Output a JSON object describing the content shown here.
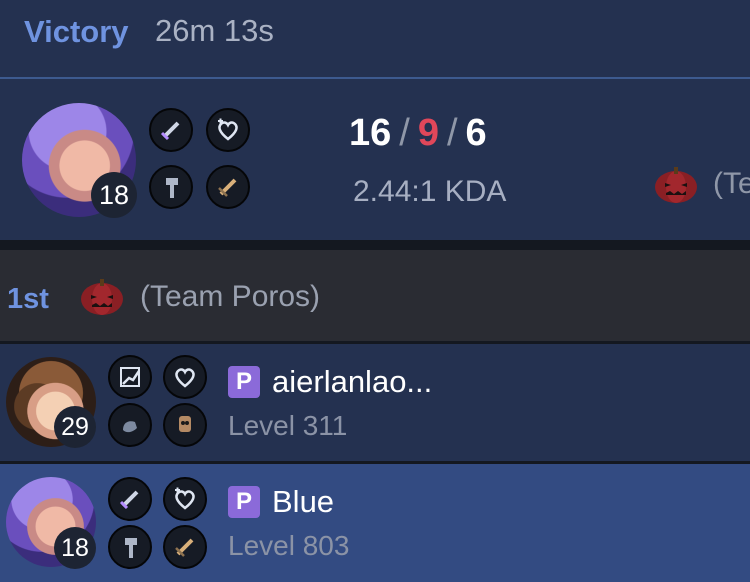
{
  "header": {
    "result": "Victory",
    "duration": "26m 13s"
  },
  "summary": {
    "champion_level": "18",
    "kills": "16",
    "deaths": "9",
    "assists": "6",
    "separator": "/",
    "kda_ratio": "2.44:1 KDA",
    "team_preview": "(Te"
  },
  "team": {
    "rank": "1st",
    "name": "(Team Poros)"
  },
  "players": [
    {
      "level_badge": "29",
      "prefix": "P",
      "name": "aierlanlao...",
      "account_level": "Level 311"
    },
    {
      "level_badge": "18",
      "prefix": "P",
      "name": "Blue",
      "account_level": "Level 803"
    }
  ],
  "colors": {
    "victory": "#6f93e0",
    "deaths": "#e0475a",
    "highlight_row": "#334b82",
    "badge": "#8b6ad9"
  },
  "icons": [
    "sword-icon",
    "heart-shield-icon",
    "hammer-icon",
    "sword-burst-icon",
    "stat-up-icon",
    "hand-icon",
    "skull-icon",
    "pumpkin-icon"
  ]
}
